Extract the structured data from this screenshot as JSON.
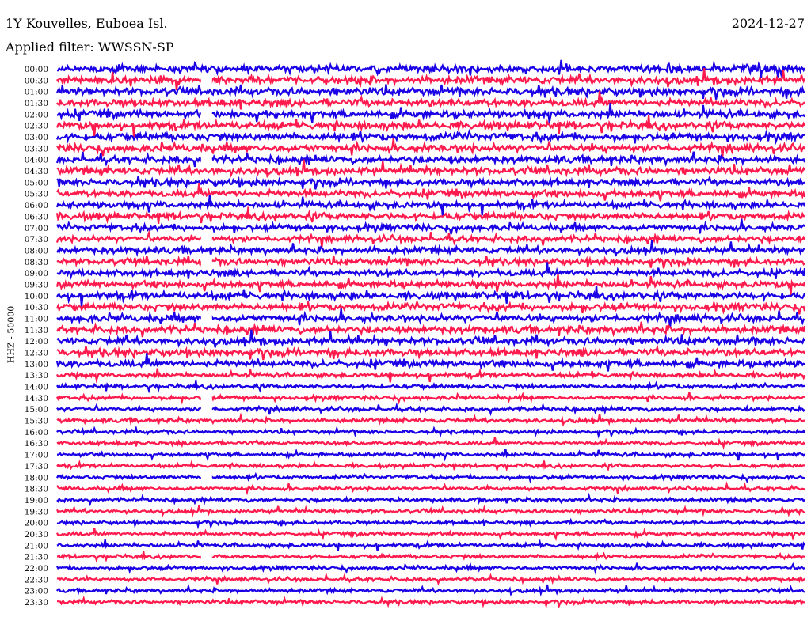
{
  "header": {
    "station": "1Y Kouvelles, Euboea Isl.",
    "date": "2024-12-27",
    "filter": "Applied filter: WWSSN-SP",
    "channel": "HHZ - 50000"
  },
  "colors": {
    "trace_a": "#1a00e6",
    "trace_b": "#ff1a4d",
    "gap": "#ffffff",
    "text": "#000000"
  },
  "chart_data": {
    "type": "helicorder",
    "title": "1Y Kouvelles, Euboea Isl.",
    "date": "2024-12-27",
    "filter": "WWSSN-SP",
    "ylabel": "HHZ - 50000",
    "row_labels": [
      "00:00",
      "00:30",
      "01:00",
      "01:30",
      "02:00",
      "02:30",
      "03:00",
      "03:30",
      "04:00",
      "04:30",
      "05:00",
      "05:30",
      "06:00",
      "06:30",
      "07:00",
      "07:30",
      "08:00",
      "08:30",
      "09:00",
      "09:30",
      "10:00",
      "10:30",
      "11:00",
      "11:30",
      "12:00",
      "12:30",
      "13:00",
      "13:30",
      "14:00",
      "14:30",
      "15:00",
      "15:30",
      "16:00",
      "16:30",
      "17:00",
      "17:30",
      "18:00",
      "18:30",
      "19:00",
      "19:30",
      "20:00",
      "20:30",
      "21:00",
      "21:30",
      "22:00",
      "22:30",
      "23:00",
      "23:30"
    ],
    "row_colors": "alternating blue/red starting blue",
    "minutes_per_row": 30,
    "relative_amplitude": [
      1.0,
      1.0,
      1.0,
      1.0,
      1.0,
      1.0,
      1.0,
      1.0,
      0.95,
      0.95,
      0.9,
      0.9,
      0.9,
      0.9,
      0.85,
      0.85,
      0.85,
      0.85,
      0.9,
      0.9,
      0.95,
      0.95,
      0.95,
      0.95,
      0.95,
      0.95,
      0.9,
      0.6,
      0.55,
      0.55,
      0.55,
      0.55,
      0.5,
      0.5,
      0.5,
      0.5,
      0.5,
      0.5,
      0.5,
      0.5,
      0.5,
      0.5,
      0.5,
      0.5,
      0.5,
      0.5,
      0.5,
      0.5
    ],
    "data_gaps_minute": 6
  }
}
